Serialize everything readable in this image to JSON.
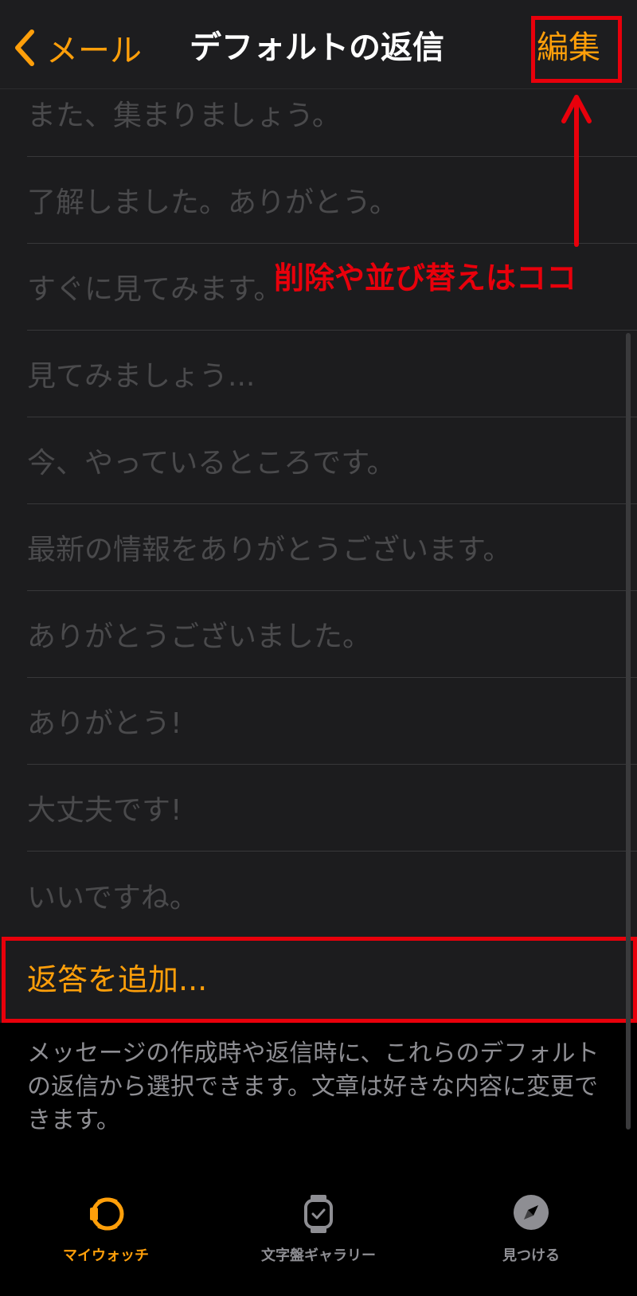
{
  "navbar": {
    "back_label": "メール",
    "title": "デフォルトの返信",
    "edit_label": "編集"
  },
  "replies": [
    "また、集まりましょう。",
    "了解しました。ありがとう。",
    "すぐに見てみます。",
    "見てみましょう...",
    "今、やっているところです。",
    "最新の情報をありがとうございます。",
    "ありがとうございました。",
    "ありがとう!",
    "大丈夫です!",
    "いいですね。"
  ],
  "add_reply_label": "返答を追加...",
  "footer_note": "メッセージの作成時や返信時に、これらのデフォルトの返信から選択できます。文章は好きな内容に変更できます。",
  "annotation": {
    "text": "削除や並び替えはココ"
  },
  "tabbar": {
    "tabs": [
      {
        "label": "マイウォッチ",
        "icon": "watch-face-icon",
        "active": true
      },
      {
        "label": "文字盤ギャラリー",
        "icon": "watch-icon",
        "active": false
      },
      {
        "label": "見つける",
        "icon": "compass-icon",
        "active": false
      }
    ]
  },
  "colors": {
    "accent": "#ff9f0a",
    "annotation": "#e8000b",
    "list_background": "#1c1c1e",
    "dimmed_text": "#4a4a4c"
  }
}
